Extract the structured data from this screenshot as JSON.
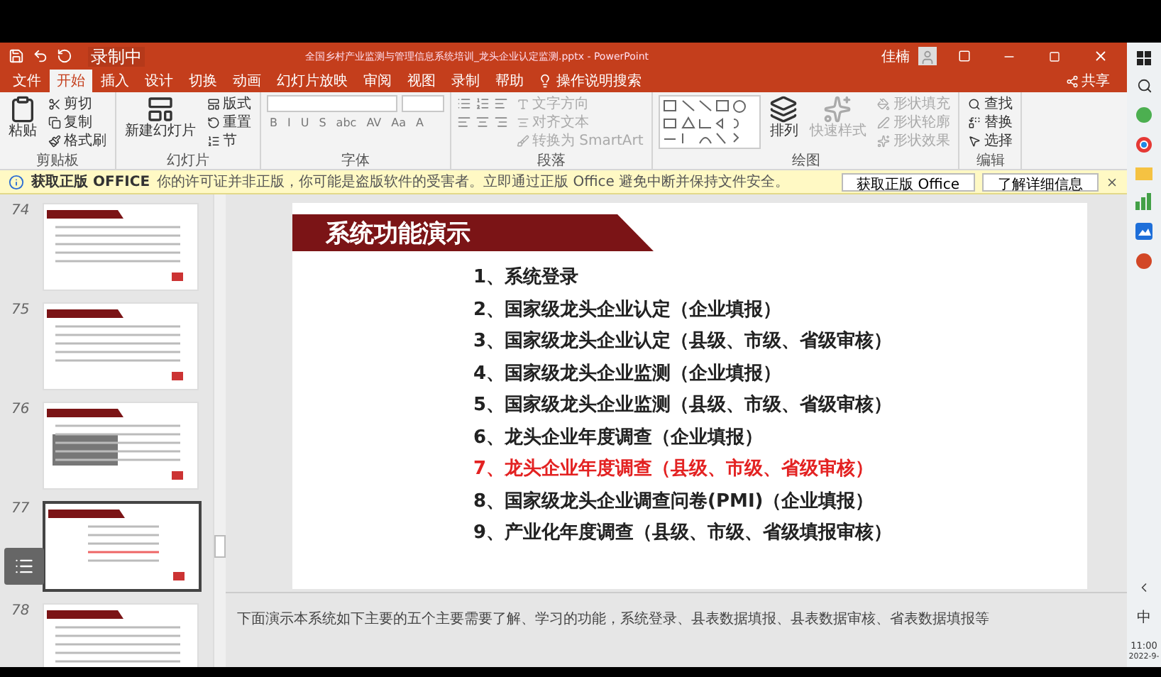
{
  "recording_badge": "录制中",
  "window": {
    "title": "全国乡村产业监测与管理信息系统培训_龙头企业认定监测.pptx - PowerPoint",
    "user": "佳楠",
    "share": "共享"
  },
  "tabs": [
    {
      "label": "文件",
      "selected": false
    },
    {
      "label": "开始",
      "selected": true
    },
    {
      "label": "插入",
      "selected": false
    },
    {
      "label": "设计",
      "selected": false
    },
    {
      "label": "切换",
      "selected": false
    },
    {
      "label": "动画",
      "selected": false
    },
    {
      "label": "幻灯片放映",
      "selected": false
    },
    {
      "label": "审阅",
      "selected": false
    },
    {
      "label": "视图",
      "selected": false
    },
    {
      "label": "录制",
      "selected": false
    },
    {
      "label": "帮助",
      "selected": false
    }
  ],
  "tell_me": "操作说明搜索",
  "ribbon": [
    {
      "name": "剪贴板",
      "kind": "buttons",
      "items": [
        {
          "kind": "large",
          "label": "粘贴",
          "disabled": false
        },
        {
          "kind": "small",
          "label": "剪切",
          "disabled": false
        },
        {
          "kind": "small",
          "label": "复制",
          "disabled": false
        },
        {
          "kind": "small",
          "label": "格式刷",
          "disabled": false
        }
      ]
    },
    {
      "name": "幻灯片",
      "kind": "buttons",
      "items": [
        {
          "kind": "large",
          "label": "新建幻灯片",
          "disabled": false
        },
        {
          "kind": "small",
          "label": "版式",
          "disabled": false
        },
        {
          "kind": "small",
          "label": "重置",
          "disabled": false
        },
        {
          "kind": "small",
          "label": "节",
          "disabled": false
        }
      ]
    },
    {
      "name": "字体",
      "kind": "font",
      "letters": [
        "B",
        "I",
        "U",
        "S",
        "abc",
        "AV",
        "Aa",
        "A"
      ]
    },
    {
      "name": "段落",
      "kind": "paragraph",
      "items": [
        {
          "kind": "small",
          "label": "文字方向",
          "disabled": true
        },
        {
          "kind": "small",
          "label": "对齐文本",
          "disabled": true
        },
        {
          "kind": "small",
          "label": "转换为 SmartArt",
          "disabled": true
        }
      ]
    },
    {
      "name": "绘图",
      "kind": "drawing",
      "items": [
        {
          "kind": "large",
          "label": "排列",
          "disabled": false
        },
        {
          "kind": "large",
          "label": "快速样式",
          "disabled": true
        },
        {
          "kind": "small",
          "label": "形状填充",
          "disabled": true
        },
        {
          "kind": "small",
          "label": "形状轮廓",
          "disabled": true
        },
        {
          "kind": "small",
          "label": "形状效果",
          "disabled": true
        }
      ]
    },
    {
      "name": "编辑",
      "kind": "buttons",
      "items": [
        {
          "kind": "small",
          "label": "查找",
          "disabled": false
        },
        {
          "kind": "small",
          "label": "替换",
          "disabled": false
        },
        {
          "kind": "small",
          "label": "选择",
          "disabled": false
        }
      ]
    }
  ],
  "info_bar": {
    "title": "获取正版 OFFICE",
    "message": "你的许可证并非正版，你可能是盗版软件的受害者。立即通过正版 Office 避免中断并保持文件安全。",
    "buttons": [
      "获取正版 Office",
      "了解详细信息"
    ]
  },
  "thumbnails": [
    {
      "number": "74",
      "selected": false
    },
    {
      "number": "75",
      "selected": false
    },
    {
      "number": "76",
      "selected": false
    },
    {
      "number": "77",
      "selected": true
    },
    {
      "number": "78",
      "selected": false
    }
  ],
  "slide": {
    "title": "系统功能演示",
    "items": [
      {
        "text": "1、系统登录",
        "highlighted": false
      },
      {
        "text": "2、国家级龙头企业认定（企业填报）",
        "highlighted": false
      },
      {
        "text": "3、国家级龙头企业认定（县级、市级、省级审核）",
        "highlighted": false
      },
      {
        "text": "4、国家级龙头企业监测（企业填报）",
        "highlighted": false
      },
      {
        "text": "5、国家级龙头企业监测（县级、市级、省级审核）",
        "highlighted": false
      },
      {
        "text": "6、龙头企业年度调查（企业填报）",
        "highlighted": false
      },
      {
        "text": "7、龙头企业年度调查（县级、市级、省级审核）",
        "highlighted": true
      },
      {
        "text": "8、国家级龙头企业调查问卷(PMI)（企业填报）",
        "highlighted": false
      },
      {
        "text": "9、产业化年度调查（县级、市级、省级填报审核）",
        "highlighted": false
      }
    ]
  },
  "notes": "下面演示本系统如下主要的五个主要需要了解、学习的功能，系统登录、县表数据填报、县表数据审核、省表数据填报等",
  "taskbar": {
    "ime": "中",
    "time": "11:00",
    "date": "2022-9-"
  }
}
